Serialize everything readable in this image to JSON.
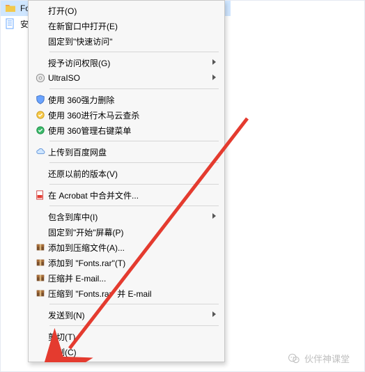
{
  "explorer": {
    "items": [
      {
        "label": "Fo",
        "icon": "folder-icon",
        "selected": true
      },
      {
        "label": "安",
        "icon": "text-file-icon",
        "selected": false
      }
    ]
  },
  "menu": [
    {
      "type": "item",
      "label": "打开(O)",
      "icon": "",
      "arrow": false
    },
    {
      "type": "item",
      "label": "在新窗口中打开(E)",
      "icon": "",
      "arrow": false
    },
    {
      "type": "item",
      "label": "固定到\"快速访问\"",
      "icon": "",
      "arrow": false
    },
    {
      "type": "sep"
    },
    {
      "type": "item",
      "label": "授予访问权限(G)",
      "icon": "",
      "arrow": true
    },
    {
      "type": "item",
      "label": "UltraISO",
      "icon": "disc-icon",
      "arrow": true
    },
    {
      "type": "sep"
    },
    {
      "type": "item",
      "label": "使用 360强力删除",
      "icon": "shield-360-icon",
      "arrow": false
    },
    {
      "type": "item",
      "label": "使用 360进行木马云查杀",
      "icon": "shield-yellow-icon",
      "arrow": false
    },
    {
      "type": "item",
      "label": "使用 360管理右键菜单",
      "icon": "shield-green-icon",
      "arrow": false
    },
    {
      "type": "sep"
    },
    {
      "type": "item",
      "label": "上传到百度网盘",
      "icon": "cloud-icon",
      "arrow": false
    },
    {
      "type": "sep"
    },
    {
      "type": "item",
      "label": "还原以前的版本(V)",
      "icon": "",
      "arrow": false
    },
    {
      "type": "sep"
    },
    {
      "type": "item",
      "label": "在 Acrobat 中合并文件...",
      "icon": "pdf-icon",
      "arrow": false
    },
    {
      "type": "sep"
    },
    {
      "type": "item",
      "label": "包含到库中(I)",
      "icon": "",
      "arrow": true
    },
    {
      "type": "item",
      "label": "固定到\"开始\"屏幕(P)",
      "icon": "",
      "arrow": false
    },
    {
      "type": "item",
      "label": "添加到压缩文件(A)...",
      "icon": "winrar-icon",
      "arrow": false
    },
    {
      "type": "item",
      "label": "添加到 \"Fonts.rar\"(T)",
      "icon": "winrar-icon",
      "arrow": false
    },
    {
      "type": "item",
      "label": "压缩并 E-mail...",
      "icon": "winrar-icon",
      "arrow": false
    },
    {
      "type": "item",
      "label": "压缩到 \"Fonts.rar\" 并 E-mail",
      "icon": "winrar-icon",
      "arrow": false
    },
    {
      "type": "sep"
    },
    {
      "type": "item",
      "label": "发送到(N)",
      "icon": "",
      "arrow": true
    },
    {
      "type": "sep"
    },
    {
      "type": "item",
      "label": "剪切(T)",
      "icon": "",
      "arrow": false
    },
    {
      "type": "item",
      "label": "复制(C)",
      "icon": "",
      "arrow": false
    }
  ],
  "watermark": {
    "label": "伙伴神课堂"
  }
}
